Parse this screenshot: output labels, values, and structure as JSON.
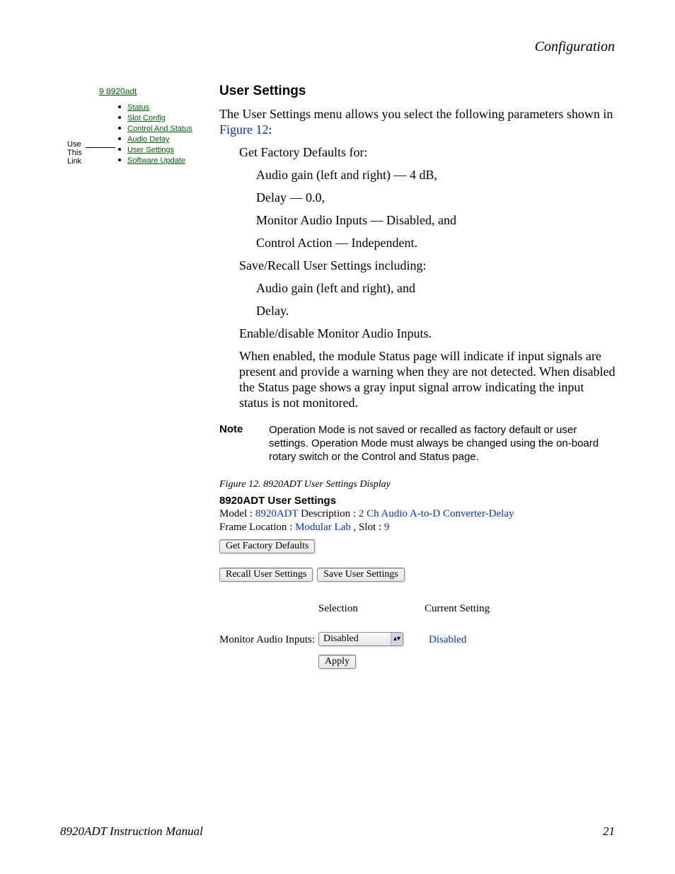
{
  "header": {
    "right": "Configuration"
  },
  "sidebar": {
    "top": "9 8920adt",
    "note_lines": [
      "Use",
      "This",
      "Link"
    ],
    "items": [
      {
        "label": "Status"
      },
      {
        "label": "Slot Config"
      },
      {
        "label": "Control And Status"
      },
      {
        "label": "Audio Delay"
      },
      {
        "label": "User Settings"
      },
      {
        "label": "Software Update"
      }
    ]
  },
  "main": {
    "heading": "User Settings",
    "intro_pre": "The User Settings menu allows you select the following parameters shown in ",
    "intro_link": "Figure 12",
    "intro_post": ":",
    "g1_lead": "Get Factory Defaults for:",
    "g1_items": [
      "Audio gain (left and right) — 4 dB,",
      "Delay — 0.0,",
      "Monitor Audio Inputs — Disabled, and",
      "Control Action — Independent."
    ],
    "g2_lead": "Save/Recall User Settings including:",
    "g2_items": [
      "Audio gain (left and right), and",
      "Delay."
    ],
    "g3": "Enable/disable Monitor Audio Inputs.",
    "g4": "When enabled, the module Status page will indicate if input signals are present and provide a warning when they are not detected. When disabled the Status page shows a gray input signal arrow indicating the input status is not monitored.",
    "note_label": "Note",
    "note_text": "Operation Mode is not saved or recalled as factory default or user settings. Operation Mode must always be changed using the on-board rotary switch or the Control and Status page.",
    "figure_caption": "Figure 12.  8920ADT User Settings Display"
  },
  "ui": {
    "title": "8920ADT User Settings",
    "line1_pre": "Model : ",
    "line1_model": "8920ADT",
    "line1_mid": " Description : ",
    "line1_desc": "2 Ch Audio A-to-D Converter-Delay",
    "line2_pre": "Frame Location : ",
    "line2_loc": "Modular Lab",
    "line2_mid": " , Slot : ",
    "line2_slot": "9",
    "btn_factory": "Get Factory Defaults",
    "btn_recall": "Recall User Settings",
    "btn_save": "Save User Settings",
    "col_selection": "Selection",
    "col_current": "Current Setting",
    "row_label": "Monitor Audio Inputs:",
    "select_value": "Disabled",
    "current_value": "Disabled",
    "btn_apply": "Apply"
  },
  "footer": {
    "left": "8920ADT Instruction Manual",
    "right": "21"
  }
}
